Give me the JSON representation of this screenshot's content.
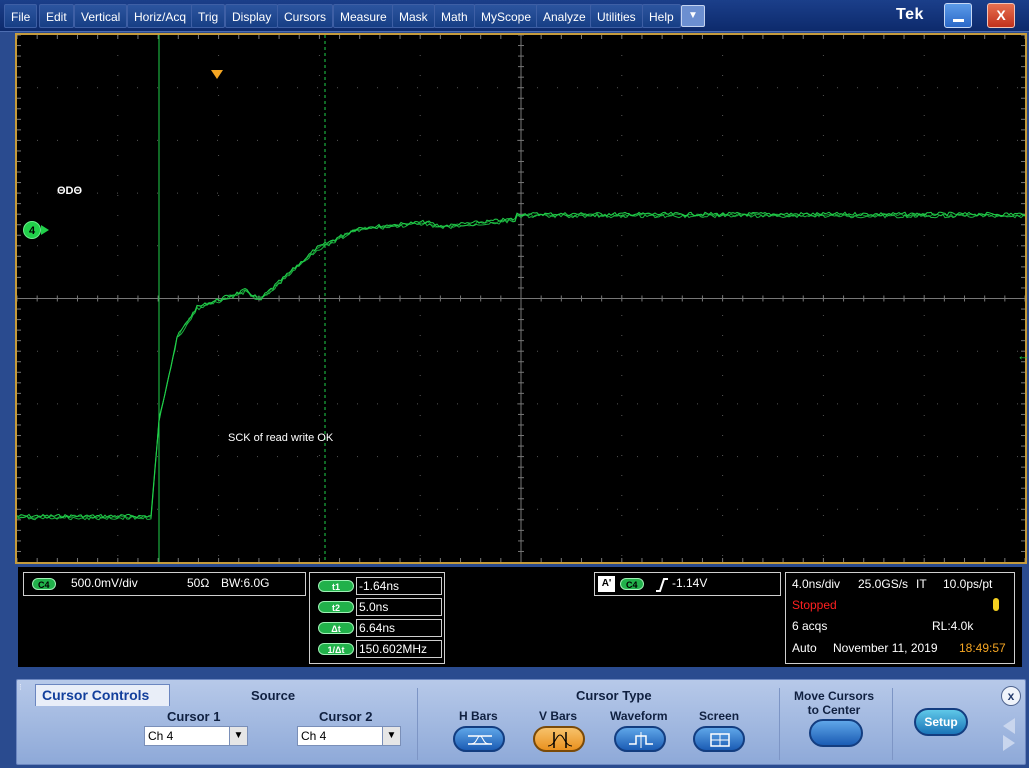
{
  "menubar": {
    "items": [
      "File",
      "Edit",
      "Vertical",
      "Horiz/Acq",
      "Trig",
      "Display",
      "Cursors",
      "Measure",
      "Mask",
      "Math",
      "MyScope",
      "Analyze",
      "Utilities",
      "Help"
    ],
    "brand": "Tek",
    "close_label": "X"
  },
  "graticule": {
    "channel_marker": "4",
    "glyph_label": "ΘDΘ",
    "annotation": "SCK of read write OK",
    "trigger_level_arrow": "←",
    "waveform_color": "#21d04a",
    "cursor_color": "#21d04a"
  },
  "channel_readout": {
    "channel": "C4",
    "scale": "500.0mV/div",
    "impedance": "50Ω",
    "bandwidth": "BW:6.0G"
  },
  "cursor_readout": {
    "t1_label": "t1",
    "t1_value": "-1.64ns",
    "t2_label": "t2",
    "t2_value": "5.0ns",
    "dt_label": "Δt",
    "dt_value": "6.64ns",
    "inv_dt_label": "1/Δt",
    "inv_dt_value": "150.602MHz"
  },
  "trigger_readout": {
    "mode_badge": "A'",
    "channel": "C4",
    "level": "-1.14V"
  },
  "acquisition": {
    "timebase": "4.0ns/div",
    "sample_rate": "25.0GS/s",
    "mode": "IT",
    "resolution": "10.0ps/pt",
    "state": "Stopped",
    "acqs": "6 acqs",
    "record_length": "RL:4.0k",
    "trigger_mode": "Auto",
    "date": "November 11, 2019",
    "time": "18:49:57"
  },
  "cursor_controls": {
    "title": "Cursor Controls",
    "source_label": "Source",
    "cursor1_label": "Cursor 1",
    "cursor1_value": "Ch 4",
    "cursor2_label": "Cursor 2",
    "cursor2_value": "Ch 4",
    "cursor_type_label": "Cursor Type",
    "types": [
      "H Bars",
      "V Bars",
      "Waveform",
      "Screen"
    ],
    "selected_type": "V Bars",
    "move_center_label_1": "Move Cursors",
    "move_center_label_2": "to Center",
    "setup_label": "Setup",
    "close_label": "x"
  }
}
